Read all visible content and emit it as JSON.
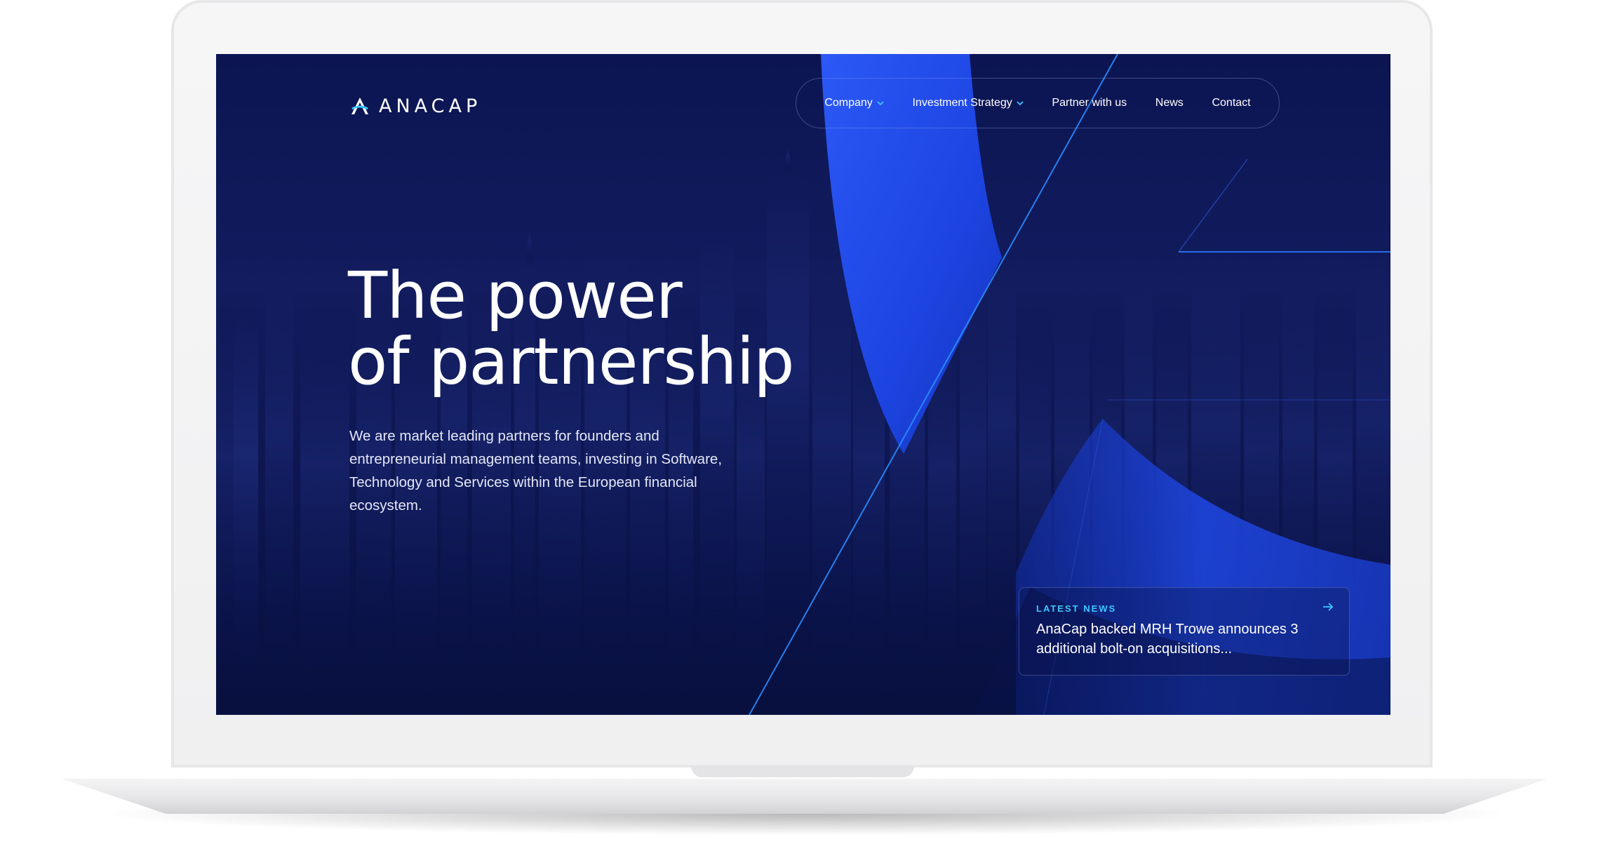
{
  "brand": {
    "name": "ANACAP"
  },
  "nav": {
    "items": [
      {
        "label": "Company",
        "has_dropdown": true
      },
      {
        "label": "Investment Strategy",
        "has_dropdown": true
      },
      {
        "label": "Partner with us",
        "has_dropdown": false
      },
      {
        "label": "News",
        "has_dropdown": false
      },
      {
        "label": "Contact",
        "has_dropdown": false
      }
    ]
  },
  "hero": {
    "headline_line1": "The power",
    "headline_line2": "of partnership",
    "description": "We are market leading partners for founders and entrepreneurial management teams, investing in Software, Technology and Services within the European financial ecosystem."
  },
  "latest_news": {
    "label": "LATEST NEWS",
    "title": "AnaCap backed MRH Trowe announces 3 additional bolt-on acquisitions...",
    "arrow_icon": "arrow-right-icon"
  },
  "colors": {
    "background": "#0c1552",
    "accent_blue": "#1f4fff",
    "accent_cyan": "#3ec7ff",
    "text": "#ffffff"
  }
}
